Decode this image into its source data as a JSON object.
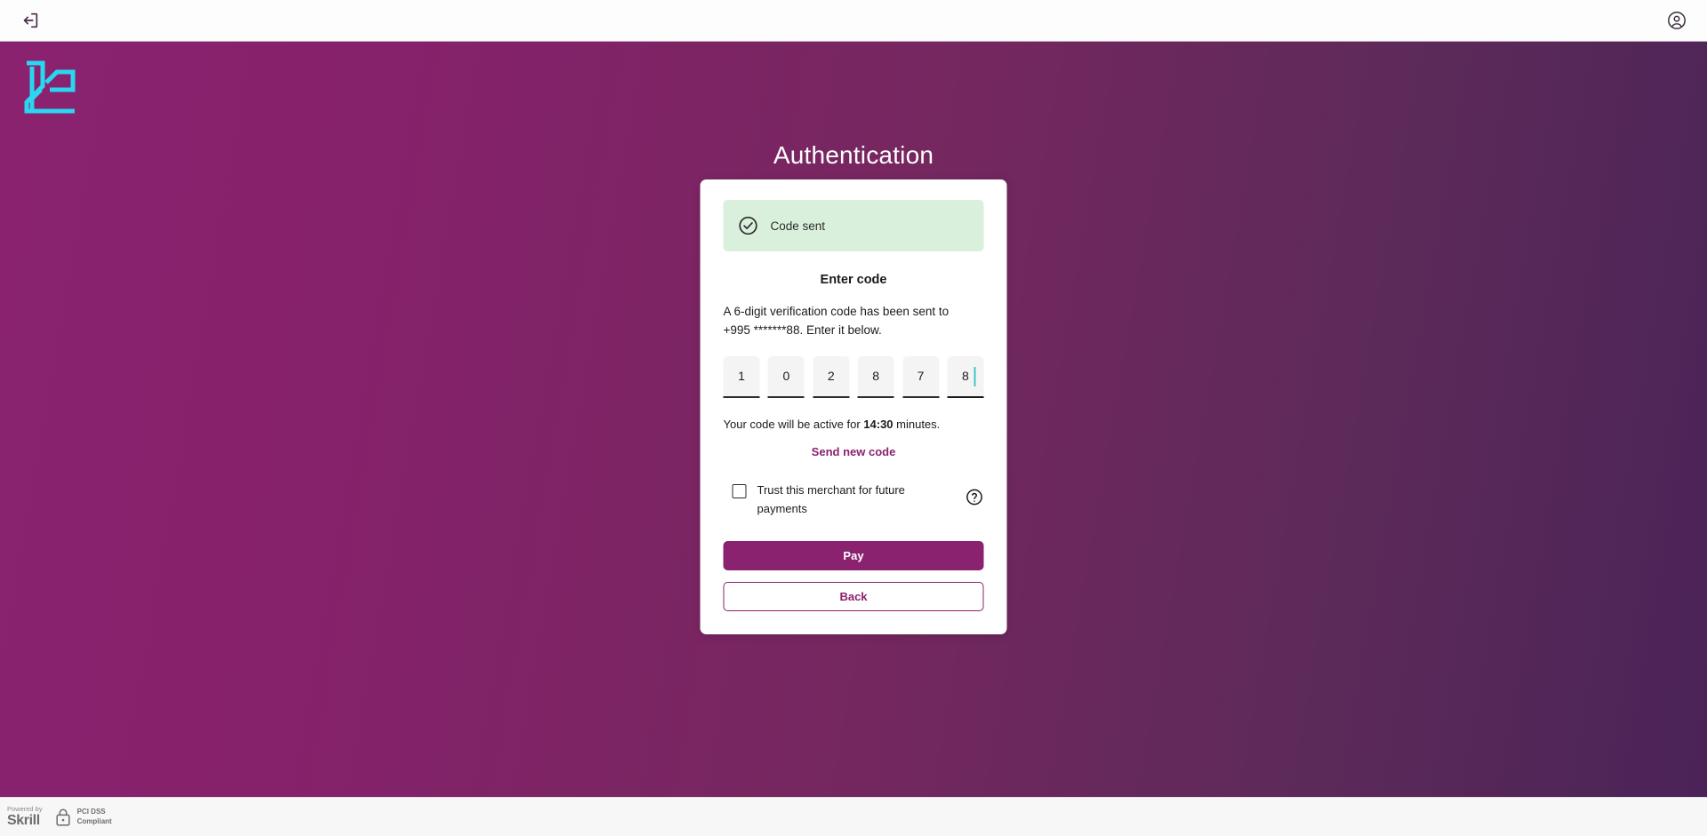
{
  "topbar": {
    "exit_icon": "exit-icon",
    "account_icon": "account-circle-icon"
  },
  "brand": {
    "logo_name": "lc-monogram-logo",
    "logo_color": "#2ad7f0"
  },
  "page": {
    "title": "Authentication",
    "background_from": "#8a2270",
    "background_to": "#4b2358"
  },
  "card": {
    "alert": {
      "icon": "check-circle-icon",
      "text": "Code sent",
      "background": "#d9f0dc"
    },
    "heading": "Enter code",
    "description_line1": "A 6-digit verification code has been sent to",
    "description_line2": "+995 *******88. Enter it below.",
    "code_inputs": [
      {
        "value": "1",
        "focused": false
      },
      {
        "value": "0",
        "focused": false
      },
      {
        "value": "2",
        "focused": false
      },
      {
        "value": "8",
        "focused": false
      },
      {
        "value": "7",
        "focused": false
      },
      {
        "value": "8",
        "focused": true
      }
    ],
    "timer_prefix": "Your code will be active for ",
    "timer_value": "14:30",
    "timer_suffix": " minutes.",
    "resend_label": "Send new code",
    "trust_checkbox": {
      "checked": false,
      "label": "Trust this merchant for future payments",
      "help_icon": "question-mark-circle-icon"
    },
    "pay_label": "Pay",
    "back_label": "Back",
    "accent_color": "#8a2270"
  },
  "footer": {
    "powered_by": "Powered by",
    "brand": "Skrill",
    "lock_icon": "padlock-icon",
    "pci_line1": "PCI DSS",
    "pci_line2": "Compliant"
  }
}
